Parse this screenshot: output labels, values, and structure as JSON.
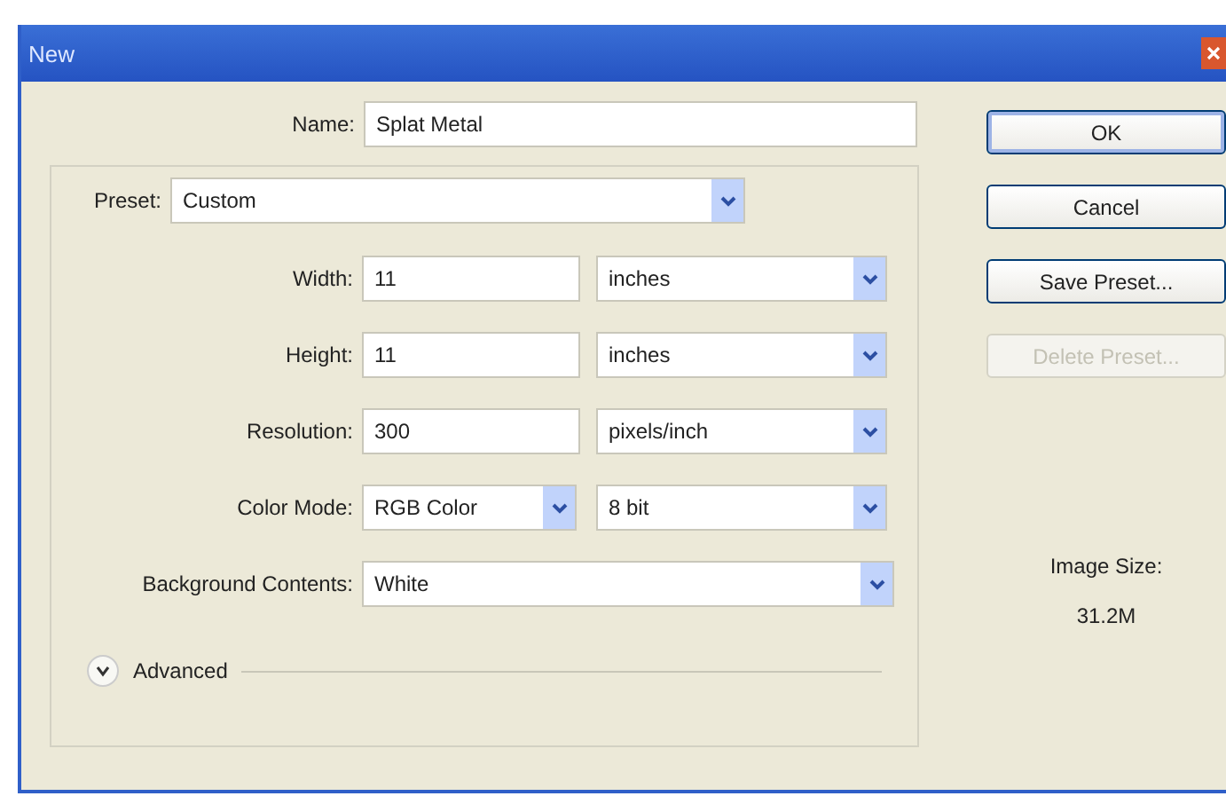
{
  "window": {
    "title": "New"
  },
  "name": {
    "label": "Name:",
    "value": "Splat Metal"
  },
  "preset": {
    "label": "Preset:",
    "value": "Custom"
  },
  "rows": [
    {
      "kind": "text_unit",
      "label": "Width:",
      "value": "11",
      "unit": "inches"
    },
    {
      "kind": "text_unit",
      "label": "Height:",
      "value": "11",
      "unit": "inches"
    },
    {
      "kind": "text_unit",
      "label": "Resolution:",
      "value": "300",
      "unit": "pixels/inch"
    },
    {
      "kind": "select_pair",
      "label": "Color Mode:",
      "value": "RGB Color",
      "unit": "8 bit"
    },
    {
      "kind": "select",
      "label": "Background Contents:",
      "value": "White"
    }
  ],
  "advanced": {
    "label": "Advanced",
    "expanded": false
  },
  "buttons": [
    {
      "label": "OK",
      "disabled": false,
      "default": true
    },
    {
      "label": "Cancel",
      "disabled": false,
      "default": false
    },
    {
      "label": "Save Preset...",
      "disabled": false,
      "default": false
    },
    {
      "label": "Delete Preset...",
      "disabled": true,
      "default": false
    }
  ],
  "image_size": {
    "label": "Image Size:",
    "value": "31.2M"
  }
}
